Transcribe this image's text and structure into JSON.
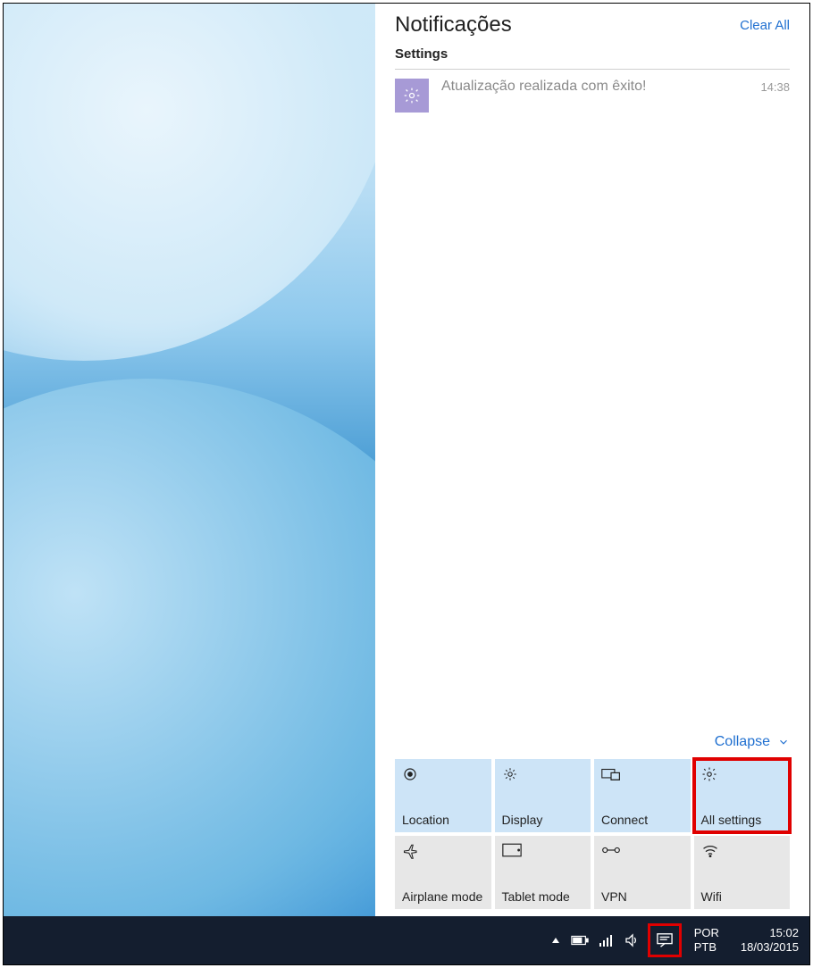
{
  "panel": {
    "title": "Notificações",
    "clear_all": "Clear All",
    "section": "Settings",
    "collapse": "Collapse"
  },
  "notification": {
    "text": "Atualização realizada com êxito!",
    "time": "14:38",
    "icon": "gear-icon"
  },
  "tiles": [
    {
      "label": "Location",
      "icon": "location-icon",
      "state": "on"
    },
    {
      "label": "Display",
      "icon": "brightness-icon",
      "state": "on"
    },
    {
      "label": "Connect",
      "icon": "connect-icon",
      "state": "on"
    },
    {
      "label": "All settings",
      "icon": "gear-icon",
      "state": "on",
      "highlight": true
    },
    {
      "label": "Airplane mode",
      "icon": "airplane-icon",
      "state": "off"
    },
    {
      "label": "Tablet mode",
      "icon": "tablet-icon",
      "state": "off"
    },
    {
      "label": "VPN",
      "icon": "vpn-icon",
      "state": "off"
    },
    {
      "label": "Wifi",
      "icon": "wifi-icon",
      "state": "off"
    }
  ],
  "taskbar": {
    "lang1": "POR",
    "lang2": "PTB",
    "time": "15:02",
    "date": "18/03/2015"
  }
}
